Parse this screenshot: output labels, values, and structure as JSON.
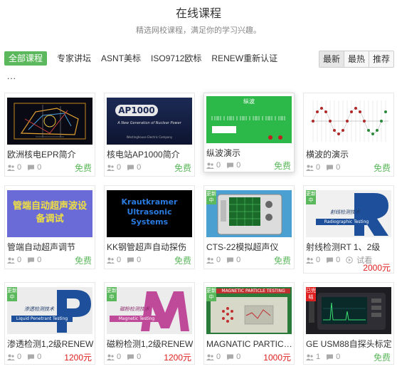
{
  "header": {
    "title": "在线课程",
    "subtitle": "精选网校课程，满足你的学习兴趣。"
  },
  "filters": {
    "tabs": [
      {
        "label": "全部课程",
        "active": true
      },
      {
        "label": "专家讲坛"
      },
      {
        "label": "ASNT美标"
      },
      {
        "label": "ISO9712欧标"
      },
      {
        "label": "RENEW重新认证"
      }
    ],
    "sorts": [
      "最新",
      "最热",
      "推荐"
    ],
    "more": "..."
  },
  "courses": [
    {
      "name": "欧洲核电EPR简介",
      "students": "0",
      "comments": "0",
      "price": "免费"
    },
    {
      "name": "核电站AP1000简介",
      "students": "0",
      "comments": "0",
      "price": "免费",
      "thumb_title": "AP1000",
      "thumb_sub": "A New Generation of Nuclear Power",
      "thumb_foot": "Westinghouse Electric Company"
    },
    {
      "name": "纵波演示",
      "students": "0",
      "comments": "0",
      "price": "免费",
      "thumb_title": "纵波"
    },
    {
      "name": "横波的演示",
      "students": "0",
      "comments": "0",
      "price": "免费"
    },
    {
      "name": "管端自动超声调节",
      "students": "0",
      "comments": "0",
      "price": "免费",
      "thumb_title": "管端自动超声波设备调试"
    },
    {
      "name": "KK钢管超声自动探伤",
      "students": "0",
      "comments": "0",
      "price": "免费",
      "thumb_title": "Krautkramer Ultrasonic Systems"
    },
    {
      "name": "CTS-22模拟超声仪",
      "students": "0",
      "comments": "0",
      "price": "免费",
      "badge": "更新中"
    },
    {
      "name": "射线检测RT 1、2级",
      "students": "0",
      "comments": "0",
      "price": "2000元",
      "trial": "试看",
      "badge": "更新中",
      "thumb_title": "射线检测技术",
      "thumb_sub": "Radiographic Testing"
    },
    {
      "name": "渗透检测1,2级RENEW",
      "students": "0",
      "comments": "0",
      "price": "1200元",
      "badge": "更新中",
      "thumb_title": "渗透检测技术",
      "thumb_sub": "Liquid Penetrant Testing"
    },
    {
      "name": "磁粉检测1,2级RENEW",
      "students": "0",
      "comments": "0",
      "price": "1200元",
      "badge": "更新中",
      "thumb_title": "磁粉检测技术",
      "thumb_sub": "Magnetic Testing"
    },
    {
      "name": "MAGNATIC PARTICLE",
      "students": "0",
      "comments": "0",
      "price": "1000元",
      "badge": "更新中",
      "thumb_title": "MAGNETIC PARTICLE TESTING"
    },
    {
      "name": "GE USM88自探头标定",
      "students": "1",
      "comments": "0",
      "price": "免费",
      "badge": "已完结"
    }
  ],
  "colors": {
    "accent": "#5cb85c",
    "price_red": "#e02020"
  }
}
